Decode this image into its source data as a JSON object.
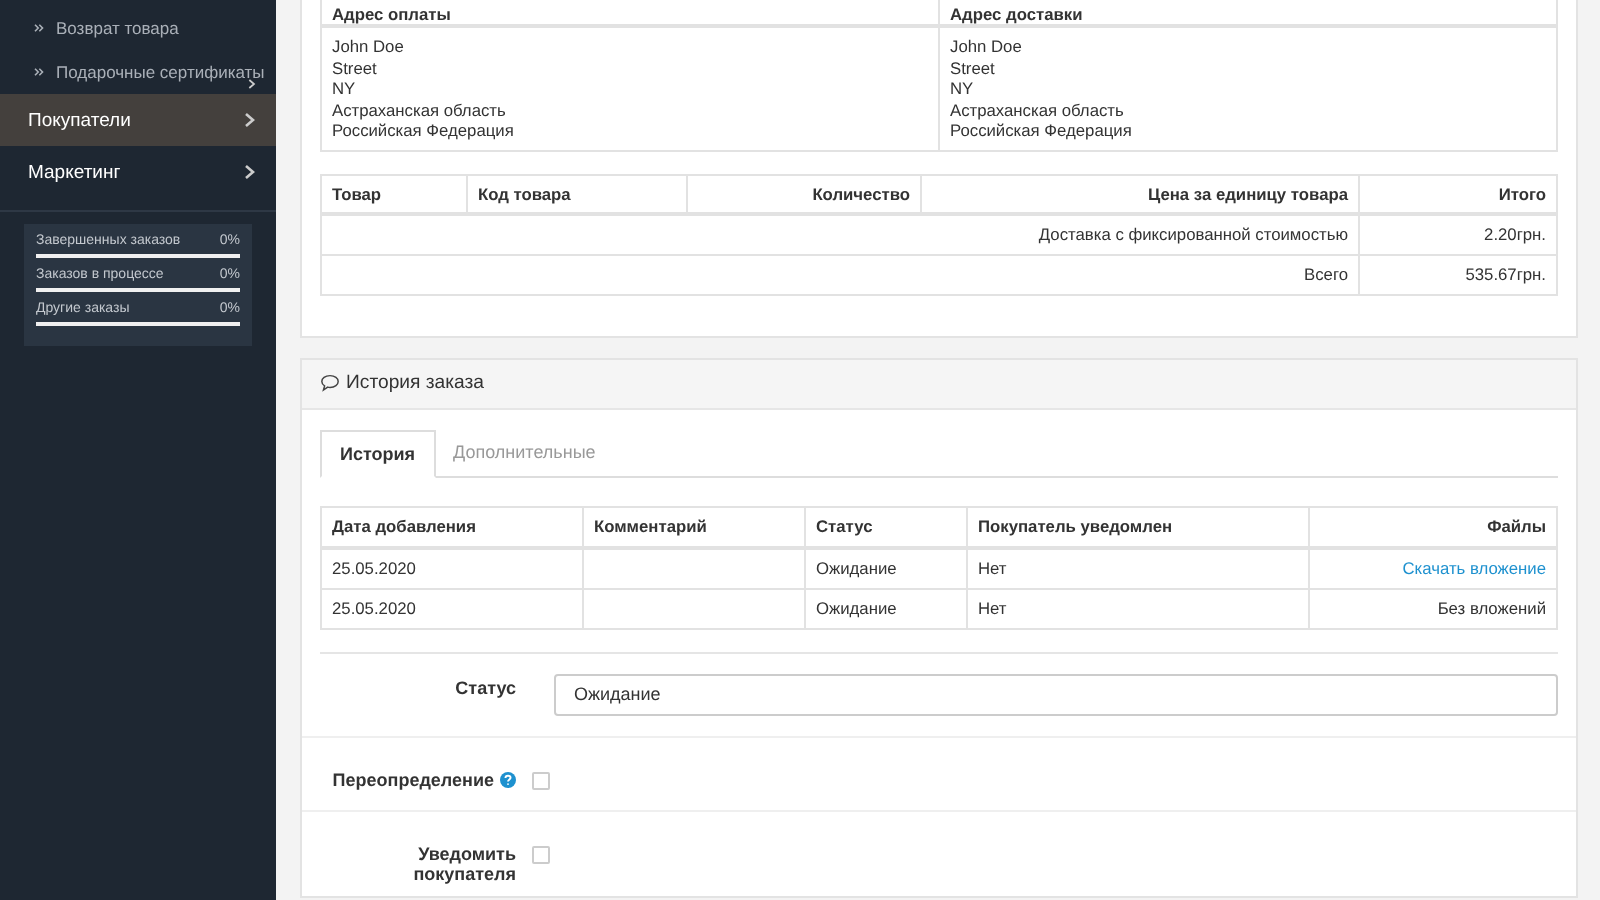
{
  "sidebar": {
    "items": [
      {
        "label": "Возврат товара",
        "kind": "sub",
        "selected": false
      },
      {
        "label": "Подарочные сертификаты",
        "kind": "sub",
        "selected": false
      },
      {
        "label": "Покупатели",
        "kind": "top",
        "selected": true
      },
      {
        "label": "Маркетинг",
        "kind": "top",
        "selected": false
      }
    ],
    "stats": [
      {
        "label": "Завершенных заказов",
        "reading": "0%",
        "level": 0
      },
      {
        "label": "Заказов в процессе",
        "reading": "0%",
        "level": 0
      },
      {
        "label": "Другие заказы",
        "reading": "0%",
        "level": 0
      }
    ]
  },
  "addresses": {
    "columns": [
      "Адрес оплаты",
      "Адрес доставки"
    ],
    "rows": [
      [
        "John Doe\nStreet\nNY\nАстраханская область\nРоссийская Федерация",
        "John Doe\nStreet\nNY\nАстраханская область\nРоссийская Федерация"
      ]
    ]
  },
  "products": {
    "columns": [
      "Товар",
      "Код товара",
      "Количество",
      "Цена за единицу товара",
      "Итого"
    ],
    "totals": [
      {
        "label": "Доставка с фиксированной стоимостью",
        "value": "2.20грн."
      },
      {
        "label": "Всего",
        "value": "535.67грн."
      }
    ]
  },
  "history": {
    "title": "История заказа",
    "tabs": [
      {
        "label": "История",
        "selected": true
      },
      {
        "label": "Дополнительные",
        "selected": false
      }
    ],
    "columns": [
      "Дата добавления",
      "Комментарий",
      "Статус",
      "Покупатель уведомлен",
      "Файлы"
    ],
    "rows": [
      {
        "cells": [
          "25.05.2020",
          "",
          "Ожидание",
          "Нет"
        ],
        "file": {
          "kind": "link",
          "text": "Скачать вложение"
        }
      },
      {
        "cells": [
          "25.05.2020",
          "",
          "Ожидание",
          "Нет"
        ],
        "file": {
          "kind": "text",
          "text": "Без вложений"
        }
      }
    ],
    "form": [
      {
        "kind": "select",
        "label": "Статус",
        "value": "Ожидание"
      },
      {
        "kind": "checkbox",
        "label": "Переопределение",
        "help": true,
        "checked": false
      },
      {
        "kind": "checkbox",
        "label": "Уведомить покупателя",
        "help": false,
        "checked": false
      }
    ]
  }
}
